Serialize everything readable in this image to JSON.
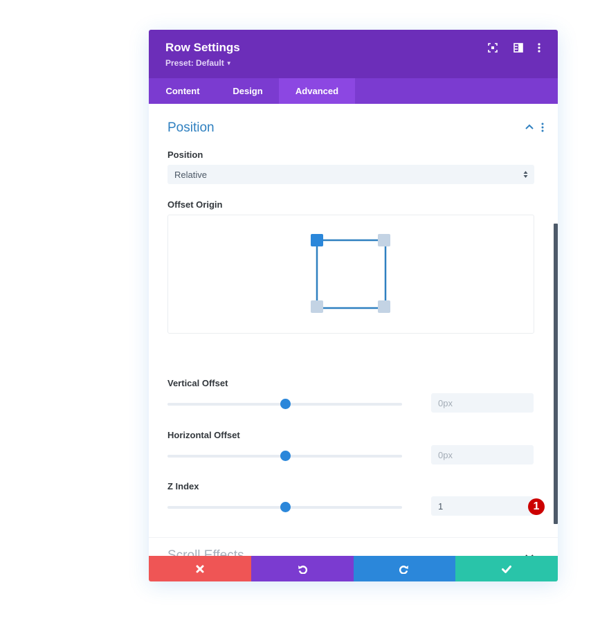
{
  "modal": {
    "title": "Row Settings",
    "preset_label": "Preset: Default",
    "header_icons": [
      "fullscreen-icon",
      "split-view-icon",
      "more-options-icon"
    ]
  },
  "tabs": [
    {
      "label": "Content",
      "active": false
    },
    {
      "label": "Design",
      "active": false
    },
    {
      "label": "Advanced",
      "active": true
    }
  ],
  "position_section": {
    "title": "Position",
    "expanded": true,
    "position_field": {
      "label": "Position",
      "selected": "Relative"
    },
    "offset_origin": {
      "label": "Offset Origin",
      "selected_corner": "top-left",
      "corners": [
        "top-left",
        "top-right",
        "bottom-left",
        "bottom-right"
      ]
    },
    "vertical_offset": {
      "label": "Vertical Offset",
      "value": "",
      "placeholder": "0px",
      "slider_fraction": 0.5
    },
    "horizontal_offset": {
      "label": "Horizontal Offset",
      "value": "",
      "placeholder": "0px",
      "slider_fraction": 0.5
    },
    "z_index": {
      "label": "Z Index",
      "value": "1",
      "slider_fraction": 0.5,
      "annotation_badge": "1"
    }
  },
  "scroll_effects_section": {
    "title": "Scroll Effects",
    "expanded": false
  },
  "footer": {
    "buttons": [
      {
        "name": "discard",
        "icon": "close-icon",
        "color": "#ef5555"
      },
      {
        "name": "undo",
        "icon": "undo-icon",
        "color": "#7b3bd0"
      },
      {
        "name": "redo",
        "icon": "redo-icon",
        "color": "#2b87da"
      },
      {
        "name": "save",
        "icon": "check-icon",
        "color": "#29c4a9"
      }
    ]
  },
  "colors": {
    "header": "#6c2eb9",
    "tabs": "#7b3bd0",
    "active_tab": "#8c47e2",
    "accent": "#2b87da",
    "badge": "#cc0000"
  }
}
